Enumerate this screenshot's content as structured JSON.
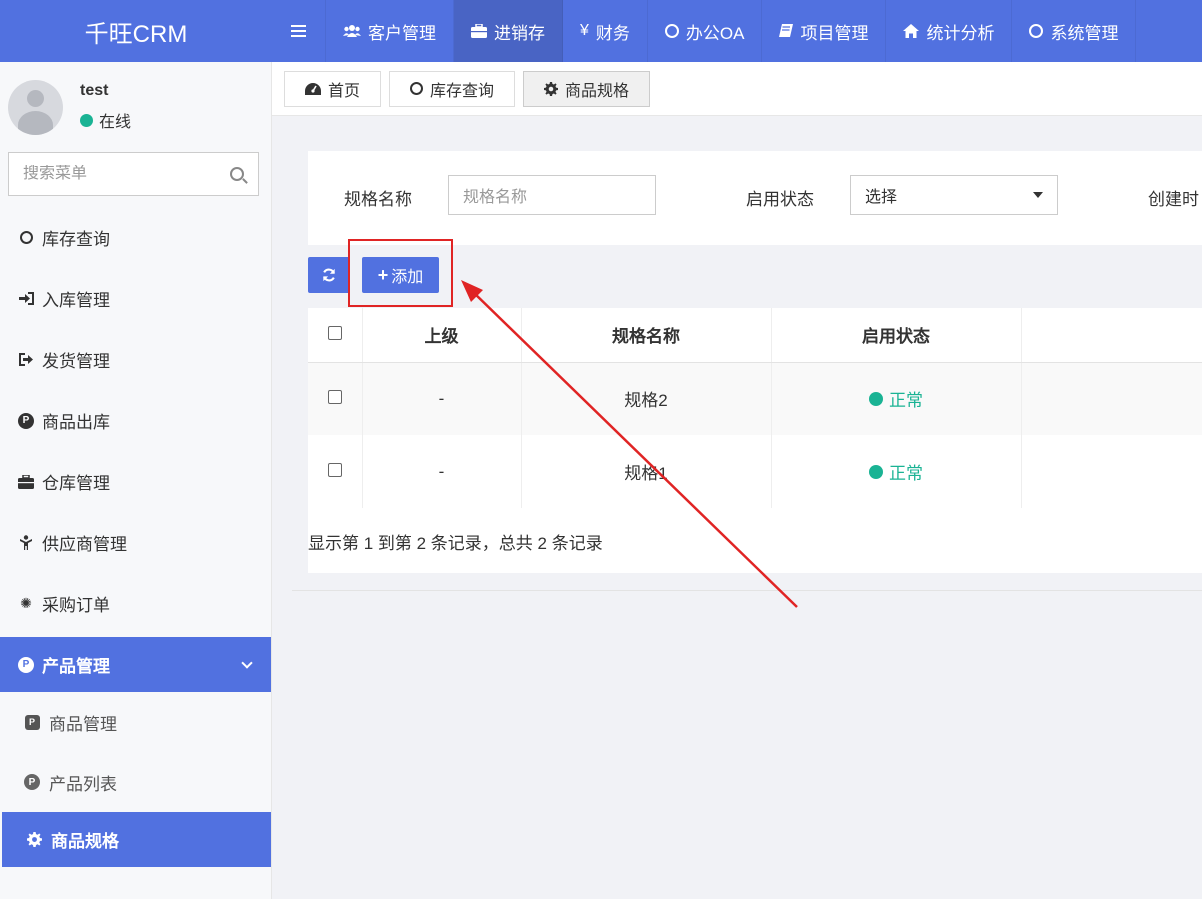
{
  "brand": "千旺CRM",
  "nav": [
    {
      "label": "客户管理",
      "icon": "users-icon"
    },
    {
      "label": "进销存",
      "icon": "briefcase-icon",
      "active": true
    },
    {
      "label": "财务",
      "icon": "yen-icon"
    },
    {
      "label": "办公OA",
      "icon": "circle-icon"
    },
    {
      "label": "项目管理",
      "icon": "book-icon"
    },
    {
      "label": "统计分析",
      "icon": "home-icon"
    },
    {
      "label": "系统管理",
      "icon": "circle-icon"
    }
  ],
  "user": {
    "name": "test",
    "status": "在线"
  },
  "sidebar": {
    "search_placeholder": "搜索菜单",
    "items": [
      {
        "label": "库存查询",
        "icon": "circle-icon"
      },
      {
        "label": "入库管理",
        "icon": "sign-in-icon"
      },
      {
        "label": "发货管理",
        "icon": "sign-out-icon"
      },
      {
        "label": "商品出库",
        "icon": "product-hunt-icon"
      },
      {
        "label": "仓库管理",
        "icon": "briefcase-icon"
      },
      {
        "label": "供应商管理",
        "icon": "child-icon"
      },
      {
        "label": "采购订单",
        "icon": "snowflake-icon"
      }
    ],
    "group": {
      "label": "产品管理",
      "icon": "product-hunt-icon"
    },
    "sub_items": [
      {
        "label": "商品管理",
        "icon": "product-square-icon"
      },
      {
        "label": "产品列表",
        "icon": "product-hunt-icon"
      },
      {
        "label": "商品规格",
        "icon": "gear-icon",
        "active": true
      }
    ]
  },
  "tabs": [
    {
      "label": "首页",
      "icon": "dashboard-icon"
    },
    {
      "label": "库存查询",
      "icon": "circle-icon"
    },
    {
      "label": "商品规格",
      "icon": "gear-icon",
      "active": true
    }
  ],
  "search_form": {
    "spec_name_label": "规格名称",
    "spec_name_placeholder": "规格名称",
    "status_label": "启用状态",
    "status_value": "选择",
    "created_label": "创建时"
  },
  "toolbar": {
    "add_label": "添加"
  },
  "table": {
    "headers": [
      "上级",
      "规格名称",
      "启用状态"
    ],
    "rows": [
      {
        "parent": "-",
        "name": "规格2",
        "status": "正常"
      },
      {
        "parent": "-",
        "name": "规格1",
        "status": "正常"
      }
    ]
  },
  "pagination_info": "显示第 1 到第 2 条记录，总共 2 条记录",
  "colors": {
    "primary": "#5171e0",
    "success": "#1ab394",
    "annotation": "#e02424"
  }
}
